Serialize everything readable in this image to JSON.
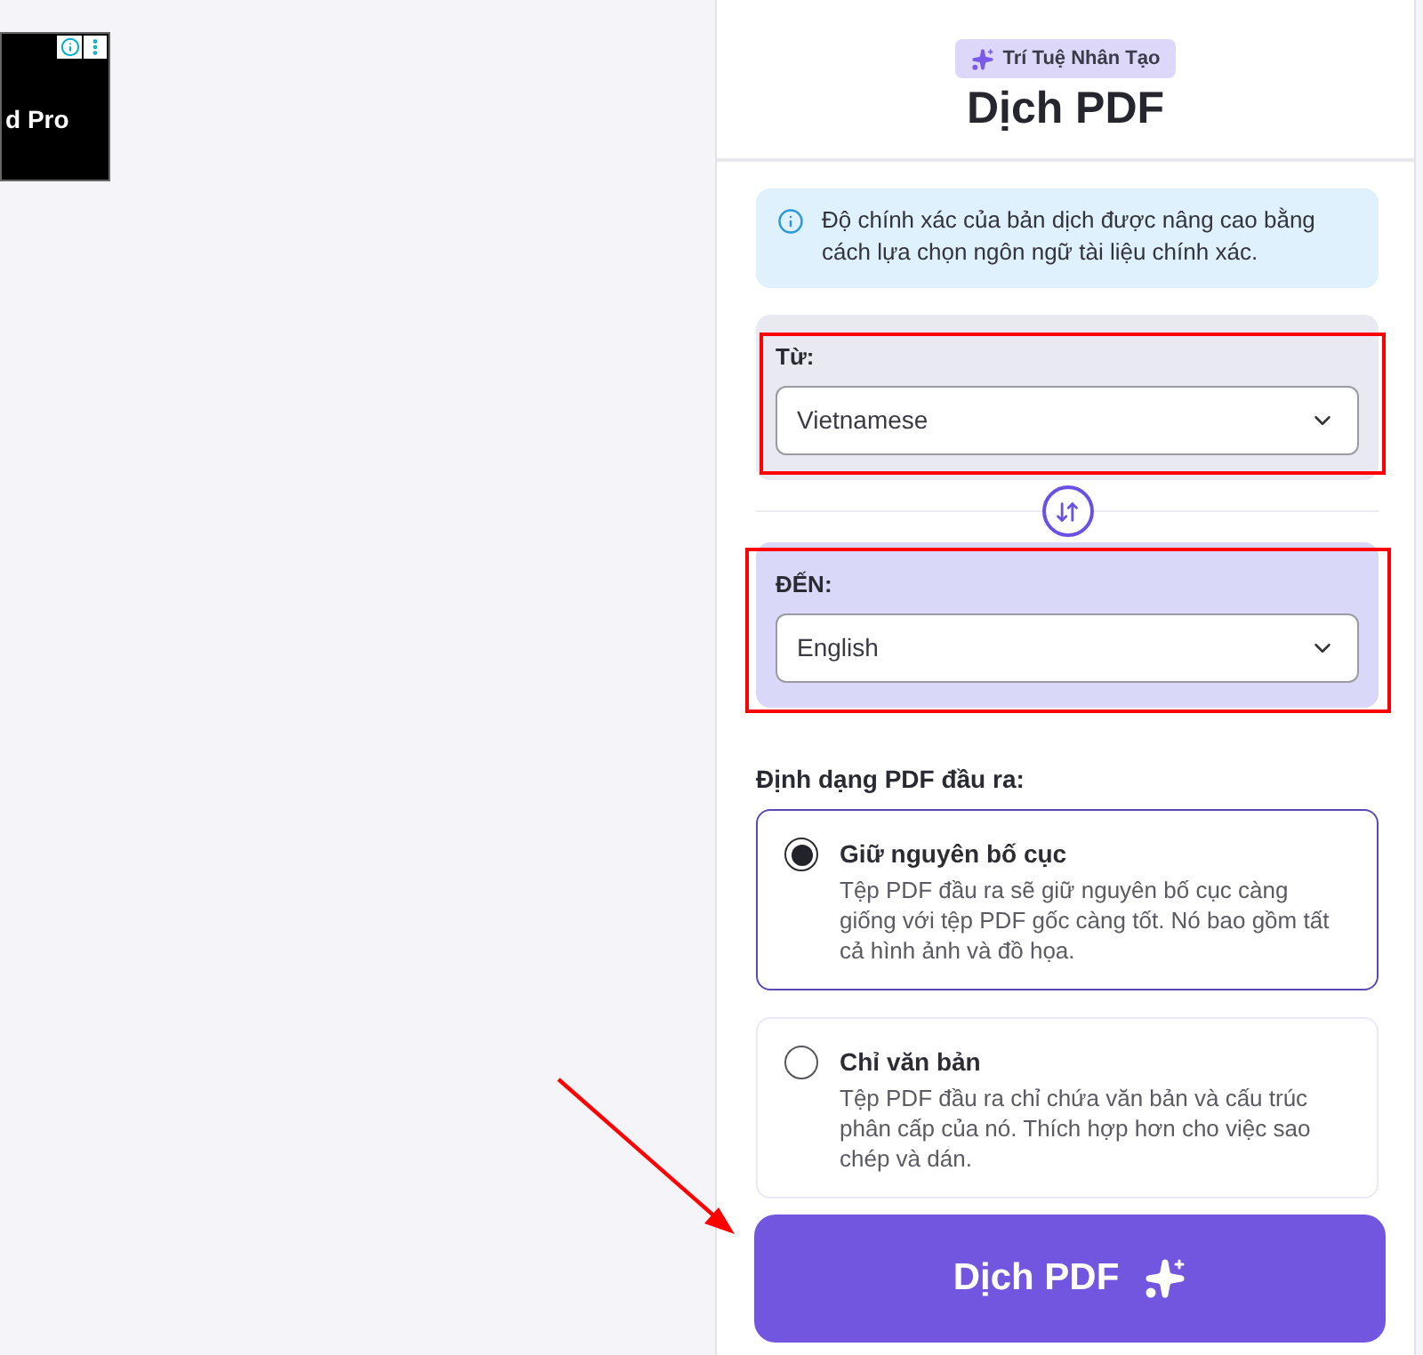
{
  "ad": {
    "text": "d Pro"
  },
  "header": {
    "badge": "Trí Tuệ Nhân Tạo",
    "title": "Dịch PDF"
  },
  "info": {
    "text": "Độ chính xác của bản dịch được nâng cao bằng cách lựa chọn ngôn ngữ tài liệu chính xác."
  },
  "languages": [
    {
      "label": "Từ:",
      "value": "Vietnamese",
      "selected": false,
      "annotated": true
    },
    {
      "label": "ĐẾN:",
      "value": "English",
      "selected": true,
      "annotated": true
    }
  ],
  "output_format": {
    "label": "Định dạng PDF đầu ra:",
    "options": [
      {
        "title": "Giữ nguyên bố cục",
        "description": "Tệp PDF đầu ra sẽ giữ nguyên bố cục càng giống với tệp PDF gốc càng tốt. Nó bao gồm tất cả hình ảnh và đồ họa.",
        "selected": true
      },
      {
        "title": "Chỉ văn bản",
        "description": "Tệp PDF đầu ra chỉ chứa văn bản và cấu trúc phân cấp của nó. Thích hợp hơn cho việc sao chép và dán.",
        "selected": false
      }
    ]
  },
  "submit": {
    "label": "Dịch PDF",
    "annotated": true
  }
}
